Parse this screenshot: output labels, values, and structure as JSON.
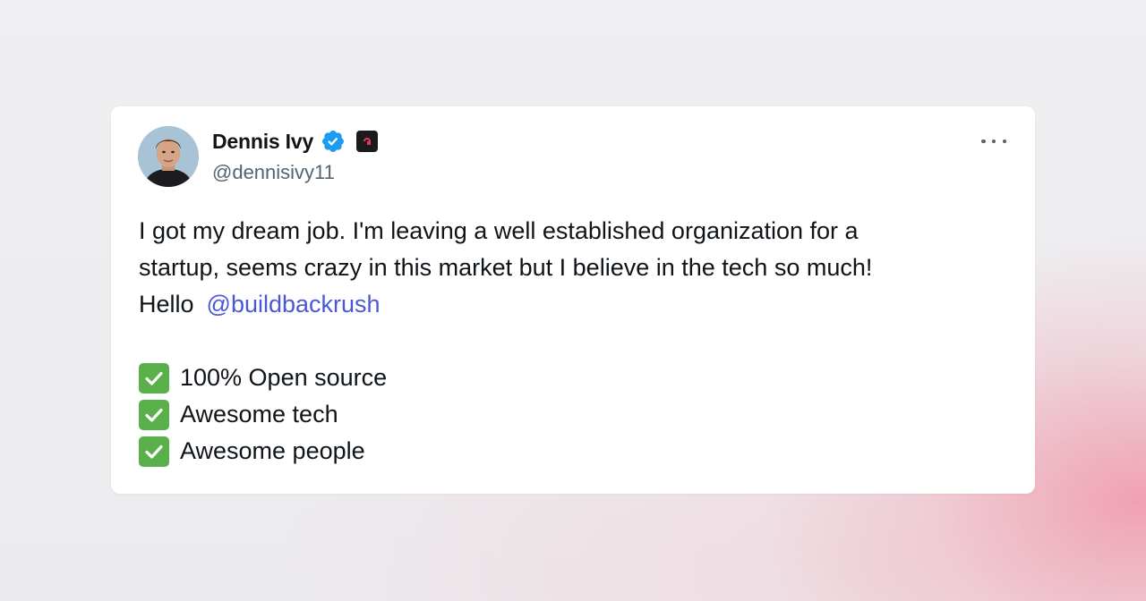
{
  "author": {
    "display_name": "Dennis Ivy",
    "handle": "@dennisivy11",
    "verified": true,
    "avatar_icon": "user-avatar-photo",
    "org_badge_icon": "organization-badge-icon"
  },
  "tweet": {
    "lines": [
      "I got my dream job. I'm leaving a well established organization for a",
      "startup, seems crazy in this market but I believe in the tech so much!"
    ],
    "hello_text": "Hello",
    "mention": "@buildbackrush",
    "checklist": [
      "100% Open source",
      "Awesome tech",
      "Awesome people"
    ]
  },
  "colors": {
    "mention": "#4a58d6",
    "verified": "#1d9bf0",
    "check": "#59b04a",
    "text": "#0f1419",
    "secondary": "#536471"
  }
}
